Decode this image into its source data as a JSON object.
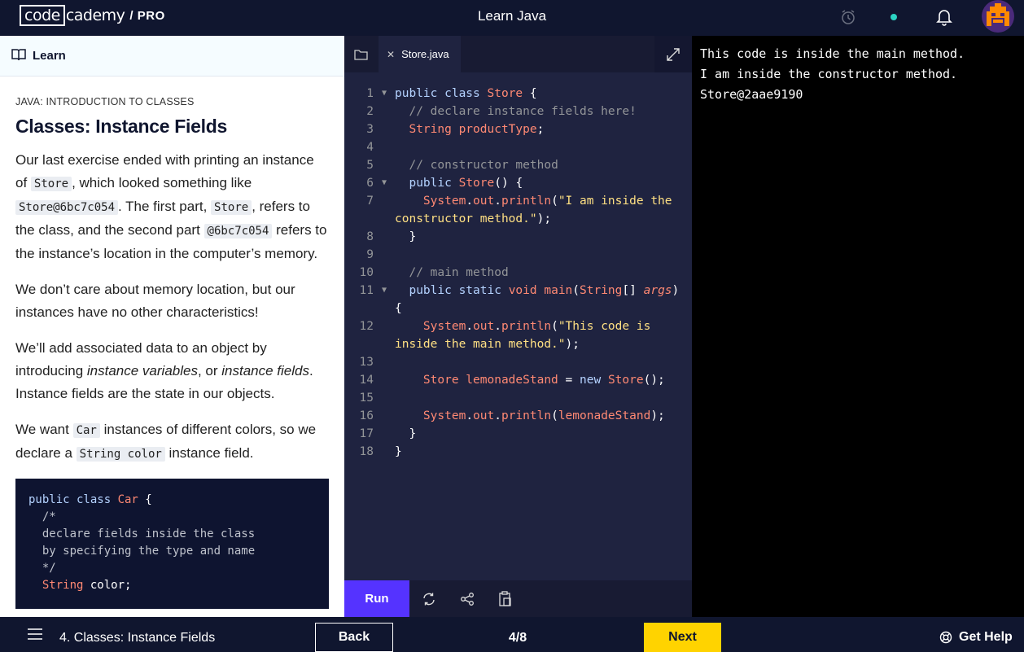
{
  "topbar": {
    "logo_box": "code",
    "logo_rest": "cademy",
    "logo_pro": "/ PRO",
    "title": "Learn Java"
  },
  "learn_panel": {
    "header_label": "Learn",
    "breadcrumb": "JAVA: INTRODUCTION TO CLASSES",
    "heading": "Classes: Instance Fields",
    "p1": {
      "a": "Our last exercise ended with printing an instance of ",
      "c1": "Store",
      "b": ", which looked something like ",
      "c2": "Store@6bc7c054",
      "d": ". The first part, ",
      "c3": "Store",
      "e": ", refers to the class, and the second part ",
      "c4": "@6bc7c054",
      "f": " refers to the instance’s location in the computer’s memory."
    },
    "p2": "We don’t care about memory location, but our instances have no other characteristics!",
    "p3": {
      "a": "We’ll add associated data to an object by introducing ",
      "em1": "instance variables",
      "b": ", or ",
      "em2": "instance fields",
      "c": ". Instance fields are the state in our objects."
    },
    "p4": {
      "a": "We want ",
      "c1": "Car",
      "b": " instances of different colors, so we declare a ",
      "c2": "String color",
      "c": " instance field."
    },
    "code_example": {
      "l1_kw": "public class ",
      "l1_name": "Car",
      "l1_rest": " {",
      "l2": "  /*",
      "l3": "  declare fields inside the class",
      "l4": "  by specifying the type and name",
      "l5": "  */",
      "l6_type": "  String",
      "l6_rest": " color;"
    }
  },
  "editor": {
    "tab_name": "Store.java",
    "run_label": "Run",
    "lines": [
      {
        "n": "1"
      },
      {
        "n": "2"
      },
      {
        "n": "3"
      },
      {
        "n": "4"
      },
      {
        "n": "5"
      },
      {
        "n": "6"
      },
      {
        "n": "7"
      },
      {
        "n": "8"
      },
      {
        "n": "9"
      },
      {
        "n": "10"
      },
      {
        "n": "11"
      },
      {
        "n": "12"
      },
      {
        "n": "13"
      },
      {
        "n": "14"
      },
      {
        "n": "15"
      },
      {
        "n": "16"
      },
      {
        "n": "17"
      },
      {
        "n": "18"
      }
    ]
  },
  "console": {
    "lines": [
      "This code is inside the main method.",
      "I am inside the constructor method.",
      "Store@2aae9190"
    ]
  },
  "bottombar": {
    "lesson_name": "4. Classes: Instance Fields",
    "back_label": "Back",
    "progress": "4/8",
    "next_label": "Next",
    "help_label": "Get Help"
  },
  "colors": {
    "run": "#5533ff",
    "next": "#ffd300",
    "status_dot": "#2cd4c4",
    "navy": "#10162f"
  }
}
